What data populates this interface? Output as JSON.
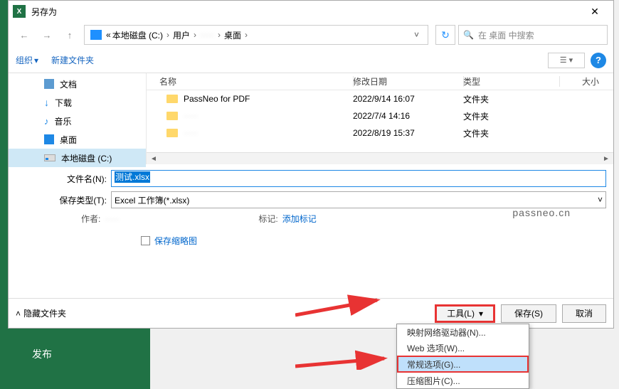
{
  "dialog": {
    "title": "另存为"
  },
  "breadcrumb": {
    "drive": "本地磁盘 (C:)",
    "users": "用户",
    "hidden": "·····",
    "desktop": "桌面"
  },
  "search": {
    "placeholder": "在 桌面 中搜索"
  },
  "toolbar": {
    "organize": "组织",
    "new_folder": "新建文件夹"
  },
  "columns": {
    "name": "名称",
    "date": "修改日期",
    "type": "类型",
    "size": "大小"
  },
  "tree": {
    "docs": "文档",
    "downloads": "下载",
    "music": "音乐",
    "desktop": "桌面",
    "cdisk": "本地磁盘 (C:)"
  },
  "files": [
    {
      "name": "PassNeo for PDF",
      "date": "2022/9/14 16:07",
      "type": "文件夹",
      "blurred": false
    },
    {
      "name": "·····",
      "date": "2022/7/4 14:16",
      "type": "文件夹",
      "blurred": true
    },
    {
      "name": "·····",
      "date": "2022/8/19 15:37",
      "type": "文件夹",
      "blurred": true
    }
  ],
  "form": {
    "filename_label": "文件名(N):",
    "filename_value": "测试.xlsx",
    "filetype_label": "保存类型(T):",
    "filetype_value": "Excel 工作簿(*.xlsx)",
    "author_label": "作者:",
    "tags_label": "标记:",
    "tags_link": "添加标记",
    "thumb_label": "保存缩略图"
  },
  "footer": {
    "hide_folders": "隐藏文件夹",
    "tools": "工具(L)",
    "save": "保存(S)",
    "cancel": "取消"
  },
  "menu": {
    "map_drive": "映射网络驱动器(N)...",
    "web_options": "Web 选项(W)...",
    "general_options": "常规选项(G)...",
    "compress_pics": "压缩图片(C)..."
  },
  "watermark": "passneo.cn",
  "bg": {
    "publish": "发布"
  }
}
